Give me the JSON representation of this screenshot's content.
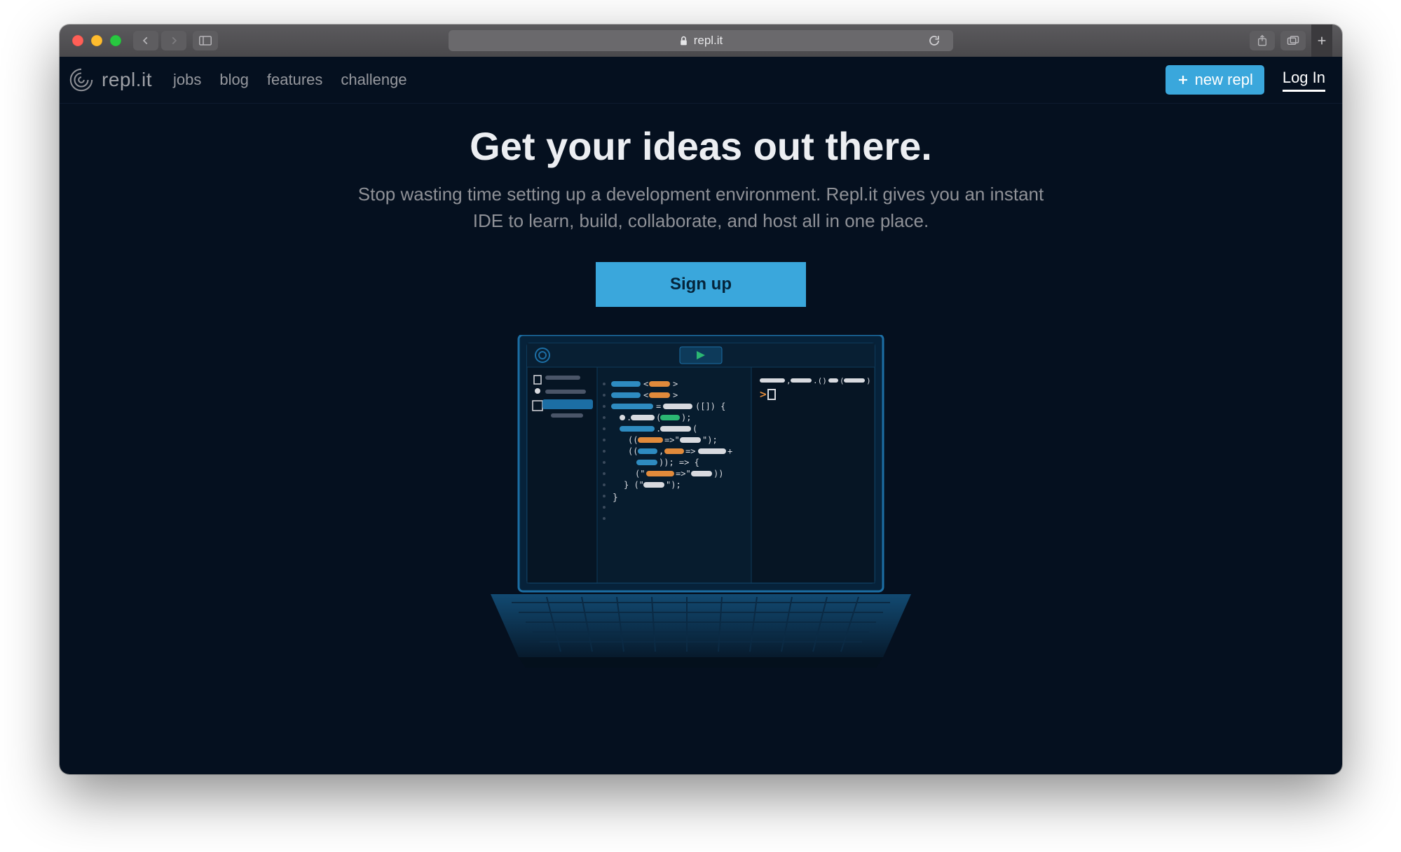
{
  "browser": {
    "url_display": "repl.it"
  },
  "nav": {
    "brand": "repl.it",
    "items": [
      "jobs",
      "blog",
      "features",
      "challenge"
    ],
    "new_repl_label": "new repl",
    "login_label": "Log In"
  },
  "hero": {
    "title": "Get your ideas out there.",
    "subtitle": "Stop wasting time setting up a development environment. Repl.it gives you an instant IDE to learn, build, collaborate, and host all in one place.",
    "signup_label": "Sign up"
  },
  "colors": {
    "page_bg": "#05101f",
    "accent": "#3aa7dc",
    "muted_text": "#8f9197",
    "code_blue": "#2e8bc0",
    "code_orange": "#e18a3b",
    "code_green": "#2bb673",
    "terminal_prompt": "#e18a3b"
  }
}
